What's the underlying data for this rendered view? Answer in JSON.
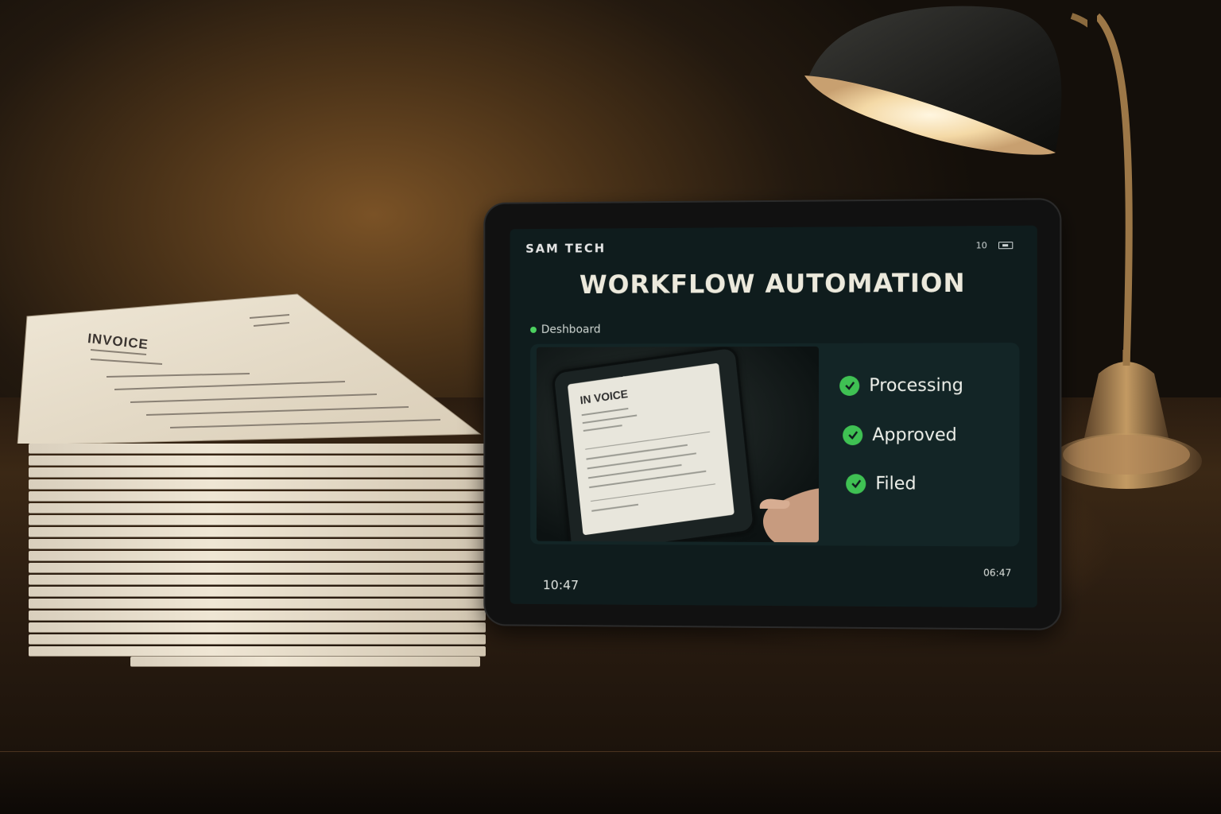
{
  "papers": {
    "title": "INVOICE"
  },
  "tablet": {
    "brand": "SAM TECH",
    "status_number": "10",
    "battery_icon": "battery-icon",
    "headline": "WORKFLOW AUTOMATION",
    "dashboard_label": "Deshboard",
    "photo": {
      "invoice_title": "IN VOICE"
    },
    "checklist": [
      {
        "label": "Processing",
        "icon": "check-circle-icon"
      },
      {
        "label": "Approved",
        "icon": "check-circle-icon"
      },
      {
        "label": "Filed",
        "icon": "check-circle-icon"
      }
    ],
    "time_left": "10:47",
    "time_right": "06:47"
  },
  "colors": {
    "check_green": "#3fc153",
    "screen_bg": "#0f1c1d",
    "lamp_light": "#f4d9a6"
  }
}
